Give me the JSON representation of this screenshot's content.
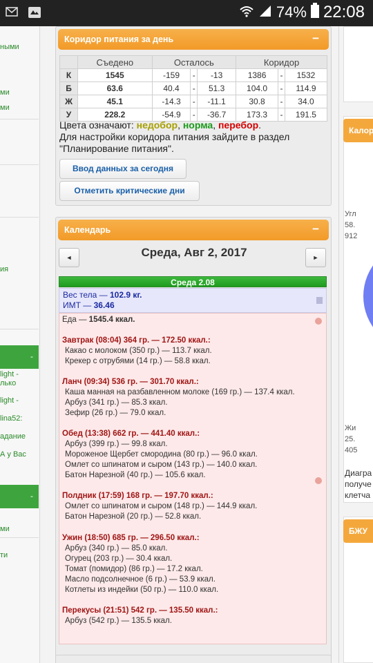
{
  "status": {
    "battery": "74%",
    "time": "22:08"
  },
  "left_fragments": [
    "ными",
    "ми",
    "ми",
    "ия",
    "-",
    "light -",
    "лько",
    "light -",
    "lina52:",
    "адание",
    "А у Вас",
    "-",
    "ми",
    "ти"
  ],
  "nutrition": {
    "title": "Коридор питания за день",
    "collapse_label": "−",
    "headers": [
      "Съедено",
      "Осталось",
      "Коридор"
    ],
    "rows": [
      {
        "label": "К",
        "eaten": "1545",
        "rem_from": "-159",
        "rem_to": "-13",
        "cor_from": "1386",
        "cor_to": "1532",
        "status": "red"
      },
      {
        "label": "Б",
        "eaten": "63.6",
        "rem_from": "40.4",
        "rem_to": "51.3",
        "cor_from": "104.0",
        "cor_to": "114.9",
        "status": "olive"
      },
      {
        "label": "Ж",
        "eaten": "45.1",
        "rem_from": "-14.3",
        "rem_to": "-11.1",
        "cor_from": "30.8",
        "cor_to": "34.0",
        "status": "red"
      },
      {
        "label": "У",
        "eaten": "228.2",
        "rem_from": "-54.9",
        "rem_to": "-36.7",
        "cor_from": "173.3",
        "cor_to": "191.5",
        "status": "red"
      }
    ],
    "dash": "-",
    "legend_prefix": "Цвета означают: ",
    "legend_under": "недобор",
    "legend_norm": "норма",
    "legend_over": "перебор",
    "legend_sep": ", ",
    "legend_end": ".",
    "settings_text": "Для настройки коридора питания зайдите в раздел \"Планирование питания\".",
    "btn_enter": "Ввод данных за сегодня",
    "btn_critical": "Отметить критические дни"
  },
  "calendar": {
    "title": "Календарь",
    "collapse_label": "−",
    "prev": "◄",
    "next": "►",
    "date": "Среда, Авг 2, 2017",
    "day_label": "Среда 2.08",
    "weight_prefix": "Вес тела — ",
    "weight_value": "102.9 кг.",
    "bmi_prefix": "ИМТ — ",
    "bmi_value": "36.46",
    "food_prefix": "Еда — ",
    "food_value": "1545.4 ккал.",
    "meals": [
      {
        "head": "Завтрак (08:04) 364 гр. — 172.50 ккал.:",
        "items": [
          "Какао с молоком (350 гр.) — 113.7 ккал.",
          "Крекер с отрубями (14 гр.) — 58.8 ккал."
        ]
      },
      {
        "head": "Ланч (09:34) 536 гр. — 301.70 ккал.:",
        "items": [
          "Каша манная на разбавленном молоке (169 гр.) — 137.4 ккал.",
          "Арбуз (341 гр.) — 85.3 ккал.",
          "Зефир (26 гр.) — 79.0 ккал."
        ]
      },
      {
        "head": "Обед (13:38) 662 гр. — 441.40 ккал.:",
        "items": [
          "Арбуз (399 гр.) — 99.8 ккал.",
          "Мороженое Щербет смородина (80 гр.) — 96.0 ккал.",
          "Омлет со шпинатом и сыром (143 гр.) — 140.0 ккал.",
          "Батон Нарезной (40 гр.) — 105.6 ккал."
        ]
      },
      {
        "head": "Полдник (17:59) 168 гр. — 197.70 ккал.:",
        "items": [
          "Омлет со шпинатом и сыром (148 гр.) — 144.9 ккал.",
          "Батон Нарезной (20 гр.) — 52.8 ккал."
        ]
      },
      {
        "head": "Ужин (18:50) 685 гр. — 296.50 ккал.:",
        "items": [
          "Арбуз (340 гр.) — 85.0 ккал.",
          "Огурец (203 гр.) — 30.4 ккал.",
          "Томат (помидор) (86 гр.) — 17.2 ккал.",
          "Масло подсолнечное (6 гр.) — 53.9 ккал.",
          "Котлеты из индейки (50 гр.) — 110.0 ккал."
        ]
      },
      {
        "head": "Перекусы (21:51) 542 гр. — 135.50 ккал.:",
        "items": [
          "Арбуз (542 гр.) — 135.5 ккал."
        ]
      }
    ]
  },
  "right_fragments": {
    "panel1_title": "Калор",
    "panel2_title": "БЖУ",
    "texts": [
      "Угл",
      "58.",
      "912",
      "Жи",
      "25.",
      "405",
      "Диагра",
      "получе",
      "клетча"
    ]
  }
}
